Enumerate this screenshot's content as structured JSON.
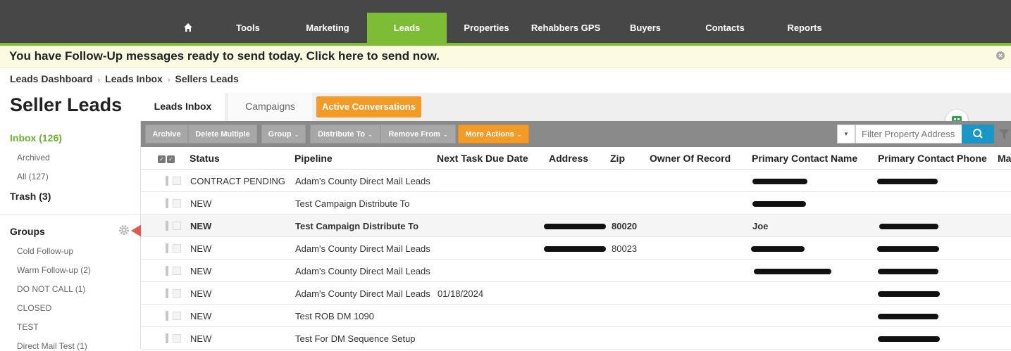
{
  "nav": {
    "items": [
      "Tools",
      "Marketing",
      "Leads",
      "Properties",
      "Rehabbers GPS",
      "Buyers",
      "Contacts",
      "Reports"
    ],
    "active": "Leads"
  },
  "banner": {
    "message": "You have Follow-Up messages ready to send today. Click here to send now.",
    "close": "×"
  },
  "breadcrumb": {
    "items": [
      "Leads Dashboard",
      "Leads Inbox",
      "Sellers Leads"
    ],
    "separator": "›"
  },
  "page_title": "Seller Leads",
  "tabs": {
    "leads_inbox": "Leads Inbox",
    "campaigns": "Campaigns",
    "active_conversations": "Active Conversations"
  },
  "sidebar": {
    "inbox": "Inbox (126)",
    "archived": "Archived",
    "all": "All (127)",
    "trash": "Trash (3)",
    "groups_label": "Groups",
    "groups": [
      "Cold Follow-up",
      "Warm Follow-up (2)",
      "DO NOT CALL (1)",
      "CLOSED",
      "TEST",
      "Direct Mail Test (1)"
    ]
  },
  "toolbar": {
    "archive": "Archive",
    "delete_multiple": "Delete Multiple",
    "group": "Group",
    "distribute_to": "Distribute To",
    "remove_from": "Remove From",
    "more_actions": "More Actions",
    "caret": "⌄",
    "filter_placeholder": "Filter Property Address",
    "filter_caret": "▼"
  },
  "table": {
    "check_glyph": "✓",
    "columns": [
      "Status",
      "Pipeline",
      "Next Task Due Date",
      "Address",
      "Zip",
      "Owner Of Record",
      "Primary Contact Name",
      "Primary Contact Phone",
      "Ma"
    ],
    "rows": [
      {
        "status": "CONTRACT PENDING",
        "pipeline": "Adam's County Direct Mail Leads",
        "due": "",
        "zip": "",
        "contact": ""
      },
      {
        "status": "NEW",
        "pipeline": "Test Campaign Distribute To",
        "due": "",
        "zip": "",
        "contact": ""
      },
      {
        "status": "NEW",
        "pipeline": "Test Campaign Distribute To",
        "due": "",
        "zip": "80020",
        "contact": "Joe"
      },
      {
        "status": "NEW",
        "pipeline": "Adam's County Direct Mail Leads",
        "due": "",
        "zip": "80023",
        "contact": ""
      },
      {
        "status": "NEW",
        "pipeline": "Adam's County Direct Mail Leads",
        "due": "",
        "zip": "",
        "contact": ""
      },
      {
        "status": "NEW",
        "pipeline": "Adam's County Direct Mail Leads",
        "due": "01/18/2024",
        "zip": "",
        "contact": ""
      },
      {
        "status": "NEW",
        "pipeline": "Test ROB DM 1090",
        "due": "",
        "zip": "",
        "contact": ""
      },
      {
        "status": "NEW",
        "pipeline": "Test For DM Sequence Setup",
        "due": "",
        "zip": "",
        "contact": ""
      }
    ]
  },
  "colors": {
    "accent_green": "#7cbd35",
    "nav_bg": "#474747",
    "orange": "#f39b27",
    "search_blue": "#1a97c9",
    "arrow_red": "#e8574b"
  }
}
